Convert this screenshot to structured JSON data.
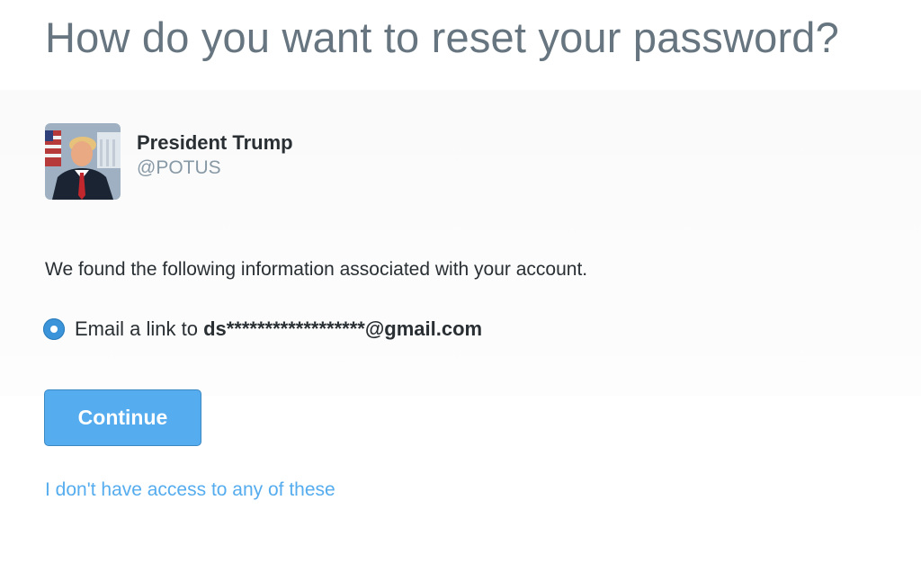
{
  "page": {
    "title": "How do you want to reset your password?"
  },
  "account": {
    "name": "President Trump",
    "handle": "@POTUS",
    "avatar_icon": "profile-photo"
  },
  "info_text": "We found the following information associated with your account.",
  "options": [
    {
      "prefix": "Email a link to ",
      "value": "ds******************@gmail.com",
      "selected": true
    }
  ],
  "continue_label": "Continue",
  "no_access_link": "I don't have access to any of these",
  "colors": {
    "title": "#66757f",
    "link": "#55acee",
    "button": "#55acee",
    "radio": "#3b94d9",
    "text": "#292f33",
    "handle": "#8899a6"
  }
}
